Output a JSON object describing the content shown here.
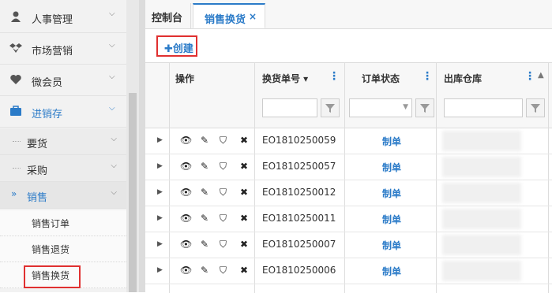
{
  "sidebar": {
    "items": [
      {
        "label": "人事管理",
        "icon": "user-icon"
      },
      {
        "label": "市场营销",
        "icon": "dropbox-icon"
      },
      {
        "label": "微会员",
        "icon": "heart-icon"
      },
      {
        "label": "进销存",
        "icon": "briefcase-icon"
      }
    ],
    "subs": [
      {
        "label": "要货"
      },
      {
        "label": "采购"
      },
      {
        "label": "销售"
      }
    ],
    "leaves": [
      {
        "label": "销售订单"
      },
      {
        "label": "销售退货"
      },
      {
        "label": "销售换货"
      }
    ],
    "accent": "#2b7bc8"
  },
  "tabs": [
    {
      "label": "控制台"
    },
    {
      "label": "销售换货",
      "close": "×"
    }
  ],
  "toolbar": {
    "create_label": "✚创建"
  },
  "grid": {
    "headers": {
      "actions": "操作",
      "number": "换货单号 ▾",
      "status": "订单状态",
      "warehouse": "出库仓库"
    },
    "rows": [
      {
        "number": "EO1810250059",
        "status": "制单"
      },
      {
        "number": "EO1810250057",
        "status": "制单"
      },
      {
        "number": "EO1810250012",
        "status": "制单"
      },
      {
        "number": "EO1810250011",
        "status": "制单"
      },
      {
        "number": "EO1810250007",
        "status": "制单"
      },
      {
        "number": "EO1810250006",
        "status": "制单"
      }
    ]
  }
}
